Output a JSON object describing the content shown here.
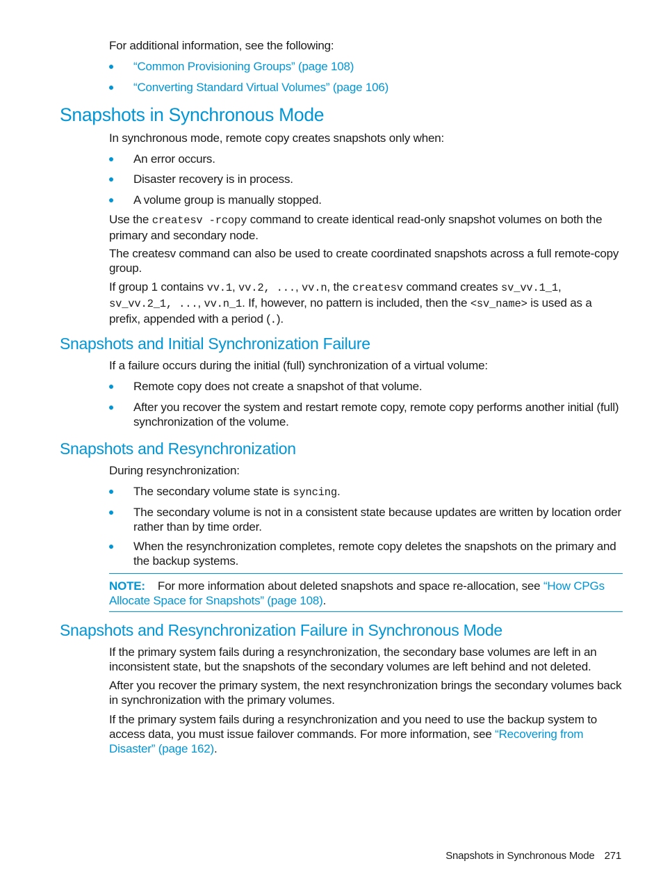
{
  "intro": {
    "text": "For additional information, see the following:",
    "links": [
      "“Common Provisioning Groups” (page 108)",
      "“Converting Standard Virtual Volumes” (page 106)"
    ]
  },
  "section1": {
    "heading": "Snapshots in Synchronous Mode",
    "intro": "In synchronous mode, remote copy creates snapshots only when:",
    "bullets": [
      "An error occurs.",
      "Disaster recovery is in process.",
      "A volume group is manually stopped."
    ],
    "para1": {
      "pre": "Use the ",
      "code": "createsv -rcopy",
      "post": " command to create identical read-only snapshot volumes on both the primary and secondary node."
    },
    "para2": "The createsv command can also be used to create coordinated snapshots across a full remote-copy group.",
    "para3": {
      "t1": "If group 1 contains ",
      "c1": "vv.1",
      "t2": ", ",
      "c2": "vv.2, ...",
      "t3": ", ",
      "c3": "vv.n",
      "t4": ", the ",
      "c4": "createsv",
      "t5": " command creates ",
      "c5": "sv_vv.1_1",
      "t6": ", ",
      "c6": "sv_vv.2_1, ...",
      "t7": ", ",
      "c7": "vv.n_1",
      "t8": ". If, however, no pattern is included, then the ",
      "c8": "<sv_name>",
      "t9": " is used as a prefix, appended with a period (",
      "c9": ".",
      "t10": ")."
    }
  },
  "section2": {
    "heading": "Snapshots and Initial Synchronization Failure",
    "intro": "If a failure occurs during the initial (full) synchronization of a virtual volume:",
    "bullets": [
      "Remote copy does not create a snapshot of that volume.",
      "After you recover the system and restart remote copy, remote copy performs another initial (full) synchronization of the volume."
    ]
  },
  "section3": {
    "heading": "Snapshots and Resynchronization",
    "intro": "During resynchronization:",
    "bullet1": {
      "pre": "The secondary volume state is ",
      "code": "syncing",
      "post": "."
    },
    "bullets": [
      "The secondary volume is not in a consistent state because updates are written by location order rather than by time order.",
      "When the resynchronization completes, remote copy deletes the snapshots on the primary and the backup systems."
    ],
    "note": {
      "label": "NOTE:",
      "text": "For more information about deleted snapshots and space re-allocation, see ",
      "link": "“How CPGs Allocate Space for Snapshots” (page 108)",
      "post": "."
    }
  },
  "section4": {
    "heading": "Snapshots and Resynchronization Failure in Synchronous Mode",
    "para1": "If the primary system fails during a resynchronization, the secondary base volumes are left in an inconsistent state, but the snapshots of the secondary volumes are left behind and not deleted.",
    "para2": "After you recover the primary system, the next resynchronization brings the secondary volumes back in synchronization with the primary volumes.",
    "para3": {
      "text": "If the primary system fails during a resynchronization and you need to use the backup system to access data, you must issue failover commands. For more information, see ",
      "link": "“Recovering from Disaster” (page 162)",
      "post": "."
    }
  },
  "footer": {
    "title": "Snapshots in Synchronous Mode",
    "page": "271"
  }
}
